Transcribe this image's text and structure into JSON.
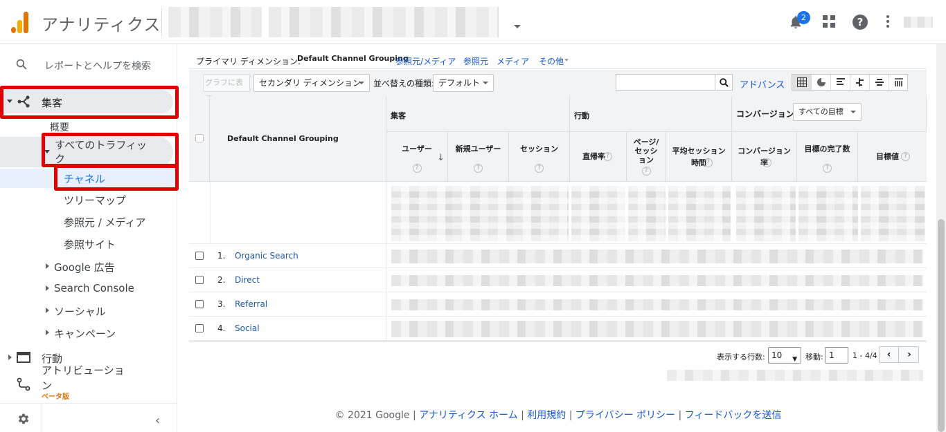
{
  "header": {
    "app_title": "アナリティクス",
    "notification_count": "2",
    "help_glyph": "?",
    "icons": [
      "analytics-logo-icon",
      "bell-icon",
      "apps-grid-icon",
      "help-icon",
      "more-vert-icon"
    ]
  },
  "sidebar": {
    "search_placeholder": "レポートとヘルプを検索",
    "acquisition": "集客",
    "overview": "概要",
    "all_traffic": "すべてのトラフィック",
    "channels": "チャネル",
    "treemap": "ツリーマップ",
    "source_medium": "参照元 / メディア",
    "referrals": "参照サイト",
    "google_ads": "Google 広告",
    "search_console": "Search Console",
    "social": "ソーシャル",
    "campaigns": "キャンペーン",
    "behavior": "行動",
    "attribution": "アトリビューション",
    "beta": "ベータ版",
    "collapse_glyph": "‹"
  },
  "dimension_bar": {
    "label": "プライマリ ディメンション:",
    "current": "Default Channel Grouping",
    "links": [
      "参照元/メディア",
      "参照元",
      "メディア",
      "その他"
    ]
  },
  "toolbar": {
    "plot_rows": "グラフに表示",
    "secondary_dimension": "セカンダリ ディメンション",
    "sort_type_label": "並べ替えの種類:",
    "sort_default": "デフォルト",
    "advanced": "アドバンス"
  },
  "table": {
    "dimension_header": "Default Channel Grouping",
    "group_acquisition": "集客",
    "group_behavior": "行動",
    "group_conversions": "コンバージョン",
    "goal_select": "すべての目標",
    "help_glyph": "?",
    "columns": [
      "ユーザー",
      "新規ユーザー",
      "セッション",
      "直帰率",
      "ページ/セッション",
      "平均セッション時間",
      "コンバージョン率",
      "目標の完了数",
      "目標値"
    ],
    "rows": [
      {
        "index": "1.",
        "name": "Organic Search"
      },
      {
        "index": "2.",
        "name": "Direct"
      },
      {
        "index": "3.",
        "name": "Referral"
      },
      {
        "index": "4.",
        "name": "Social"
      }
    ]
  },
  "pager": {
    "rows_label": "表示する行数:",
    "rows_value": "10",
    "goto_label": "移動:",
    "goto_value": "1",
    "range": "1 - 4/4",
    "prev": "‹",
    "next": "›"
  },
  "footer": {
    "copyright": "© 2021 Google",
    "links": [
      "アナリティクス ホーム",
      "利用規約",
      "プライバシー ポリシー",
      "フィードバックを送信"
    ]
  },
  "colors": {
    "accent": "#1a73e8",
    "highlight": "#e00000",
    "logo_orange": "#f9ab00",
    "logo_dark": "#e37400"
  }
}
